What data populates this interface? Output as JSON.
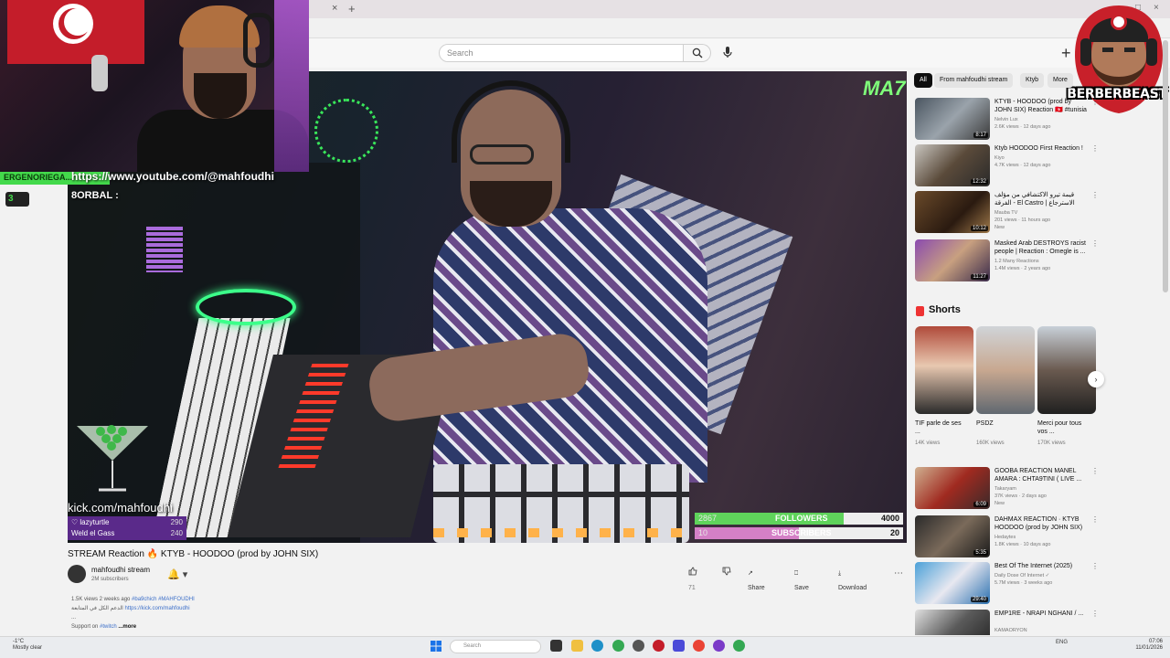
{
  "browser": {
    "tab_close": "×",
    "tab_new": "+",
    "window_controls": [
      "–",
      "□",
      "×"
    ]
  },
  "header": {
    "search_placeholder": "Search",
    "create_icon": "+"
  },
  "stream_overlay": {
    "green_badge": "ERGENORIEGA...",
    "kick_count": "3",
    "youtube_link": "https://www.youtube.com/@mahfoudhi",
    "chat_name": "8ORBAL :",
    "kick_url": "kick.com/mahfoudhi",
    "channel_logo": "MA7",
    "supporters": [
      {
        "name": "lazyturtle",
        "value": "290"
      },
      {
        "name": "Weld el Gass",
        "value": "240"
      }
    ],
    "followers": {
      "label": "FOLLOWERS",
      "current": "2867",
      "goal": "4000",
      "fraction": 0.717
    },
    "subscribers": {
      "label": "SUBSCRIBERS",
      "current": "10",
      "goal": "20",
      "fraction": 0.5
    }
  },
  "logo": {
    "text": "BERBERBEAST"
  },
  "video": {
    "title": "STREAM Reaction 🔥 KTYB - HOODOO (prod by JOHN SIX)",
    "channel": "mahfoudhi stream",
    "subs": "2M subscribers",
    "bell_label": "🔔 ▾",
    "actions": {
      "like": "71",
      "share": "Share",
      "save": "Save",
      "download": "Download",
      "more": "⋯"
    }
  },
  "description": {
    "stats": "1.5K views  2 weeks ago",
    "tags": "#ba9chich #MAHFOUDHI",
    "line2": "الدعم الكل في المتابعة",
    "link": "https://kick.com/mahfoudhi",
    "line3": "...",
    "support_prefix": "Support on ",
    "support_tag": "#twitch",
    "more": "...more"
  },
  "chips": [
    {
      "label": "All",
      "active": true
    },
    {
      "label": "From mahfoudhi stream",
      "active": false
    },
    {
      "label": "Ktyb",
      "active": false
    },
    {
      "label": "More",
      "active": false
    }
  ],
  "recommendations": [
    {
      "title": "KTYB - HOODOO (prod by JOHN SIX) Reaction 🇹🇳 #tunisia",
      "channel": "Nelvin Lux",
      "meta": "2.6K views · 12 days ago",
      "duration": "8:17"
    },
    {
      "title": "Ktyb HOODOO First Reaction !",
      "channel": "Kiyo",
      "meta": "4.7K views · 12 days ago",
      "duration": "12:32"
    },
    {
      "title": "قيمة تيرو الاكتشافي من مؤلف الفرقة - El Castro | الاسترجاع",
      "channel": "Mauba TV",
      "meta": "201 views · 11 hours ago",
      "duration": "10:12",
      "badge": "New"
    },
    {
      "title": "Masked Arab DESTROYS racist people | Reaction : Omegle is ...",
      "channel": "1.2 Many Reactions",
      "meta": "1.4M views · 2 years ago",
      "duration": "11:27"
    }
  ],
  "shorts": {
    "title": "Shorts",
    "items": [
      {
        "caption": "TIF parle de ses ...",
        "views": "14K views"
      },
      {
        "caption": "PSDZ",
        "views": "160K views"
      },
      {
        "caption": "Merci pour tous vos ...",
        "views": "170K views"
      }
    ],
    "next": "›"
  },
  "recommendations2": [
    {
      "title": "GOOBA REACTION MANEL AMARA : CHTA9TINI ( LIVE ...",
      "channel": "Takaryam",
      "meta": "37K views · 2 days ago",
      "duration": "6:09",
      "badge": "New"
    },
    {
      "title": "DAHMAX REACTION · KTYB HOODOO (prod by JOHN SIX)",
      "channel": "Hedaytes",
      "meta": "1.8K views · 10 days ago",
      "duration": "5:35"
    },
    {
      "title": "Best Of The Internet (2025)",
      "channel": "Daily Dose Of Internet ✓",
      "meta": "5.7M views · 3 weeks ago",
      "duration": "29:40"
    },
    {
      "title": "EMP1RE - NRAPI NGHANI / ...",
      "channel": "KAMAORYON",
      "meta": "",
      "duration": ""
    }
  ],
  "taskbar": {
    "weather_temp": "-1°C",
    "weather_desc": "Mostly clear",
    "search": "Search",
    "tray": "ENG",
    "time": "07:06",
    "date": "11/01/2026"
  },
  "colors": {
    "accent_red": "#ff0000",
    "followers_green": "#5fd35b",
    "subs_pink": "#d480c6"
  }
}
